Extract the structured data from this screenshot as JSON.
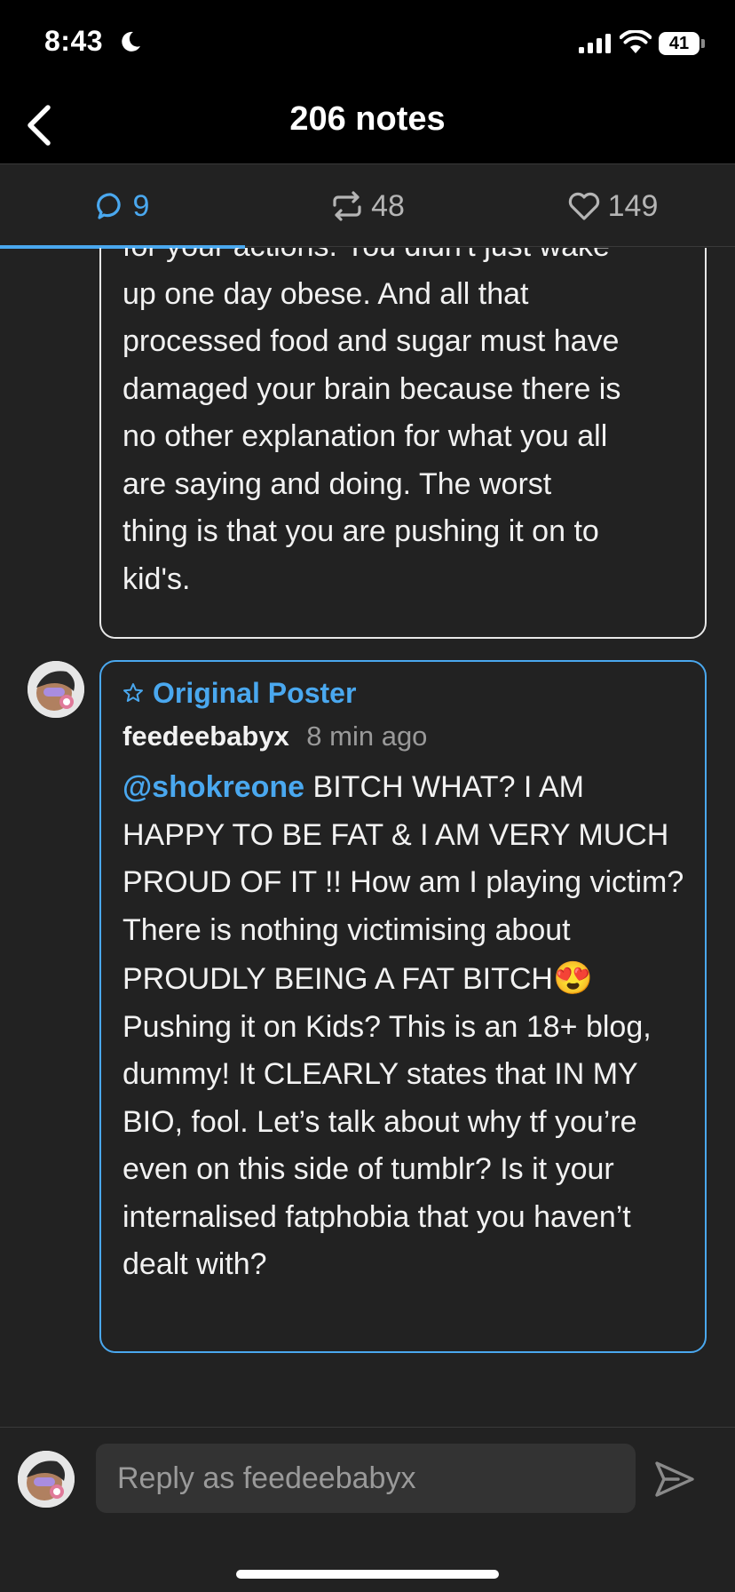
{
  "status_bar": {
    "time": "8:43",
    "battery": "41"
  },
  "header": {
    "title": "206 notes"
  },
  "tabs": [
    {
      "label": "9",
      "icon": "comment-icon",
      "active": true
    },
    {
      "label": "48",
      "icon": "reblog-icon",
      "active": false
    },
    {
      "label": "149",
      "icon": "heart-icon",
      "active": false
    }
  ],
  "thread": {
    "previous_reply": {
      "lines": [
        "for your actions. You didn't just wake",
        "up one day obese. And all that",
        "processed food and sugar must have",
        "damaged your brain because there is",
        "no other explanation for what you all",
        "are saying and doing. The worst",
        "thing is that you are pushing it on to",
        "kid's."
      ]
    },
    "op_reply": {
      "badge": "Original Poster",
      "author": "feedeebabyx",
      "timestamp": "8 min ago",
      "mention": "@shokreone",
      "text_part1": " BITCH WHAT? I AM HAPPY TO BE FAT & I AM VERY MUCH PROUD OF IT !! How am I playing victim? There is nothing victimising about PROUDLY BEING A FAT BITCH",
      "emoji": "😍",
      "text_part2": " Pushing it on Kids? This is an 18+ blog, dummy! It CLEARLY states that IN MY BIO, fool. Let’s talk about why tf you’re even on this side of tumblr? Is it your internalised fatphobia that you haven’t dealt with?"
    }
  },
  "reply_bar": {
    "placeholder": "Reply as feedeebabyx"
  },
  "colors": {
    "accent": "#4aa8ef",
    "background": "#222222",
    "header": "#000000"
  }
}
